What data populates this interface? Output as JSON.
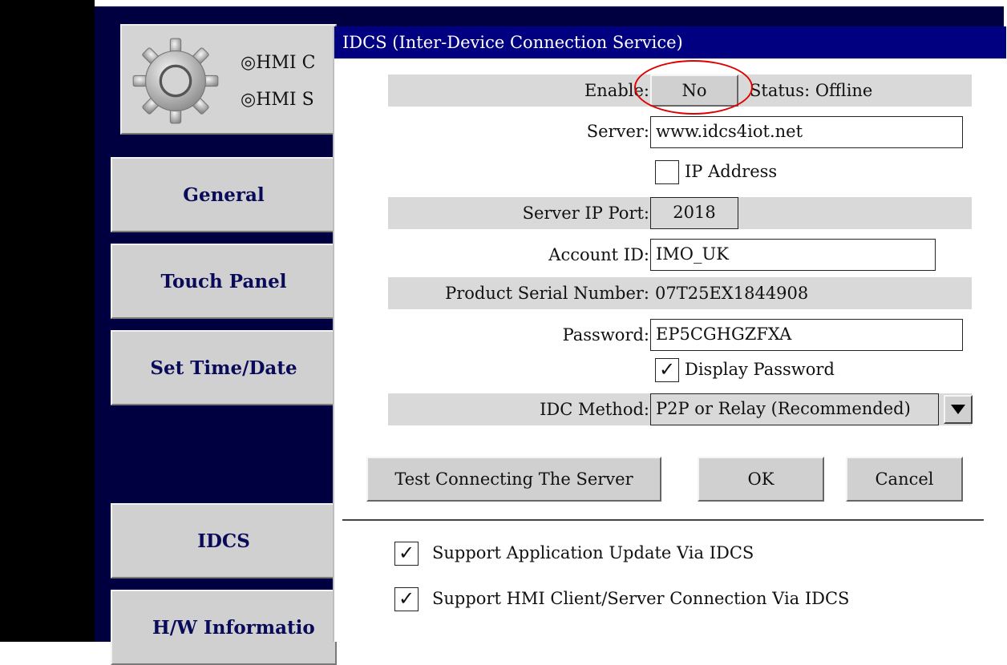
{
  "sidebar": {
    "radio_options": [
      "◎HMI C",
      "◎HMI S"
    ],
    "buttons": [
      "General",
      "Touch Panel",
      "Set Time/Date",
      "IDCS",
      "H/W Informatio"
    ]
  },
  "dialog": {
    "title": "IDCS (Inter-Device Connection Service)",
    "enable_label": "Enable:",
    "enable_value": "No",
    "status": "Status: Offline",
    "server_label": "Server:",
    "server_value": "www.idcs4iot.net",
    "ip_address_label": "IP Address",
    "ip_address_checked": false,
    "port_label": "Server IP Port:",
    "port_value": "2018",
    "account_label": "Account ID:",
    "account_value": "IMO_UK",
    "serial_label": "Product Serial Number:",
    "serial_value": "07T25EX1844908",
    "password_label": "Password:",
    "password_value": "EP5CGHGZFXA",
    "display_password_label": "Display Password",
    "display_password_checked": true,
    "method_label": "IDC Method:",
    "method_value": "P2P or Relay (Recommended)",
    "test_button": "Test Connecting The Server",
    "ok_button": "OK",
    "cancel_button": "Cancel",
    "support_update_label": "Support Application Update Via IDCS",
    "support_update_checked": true,
    "support_client_label": "Support HMI Client/Server Connection Via IDCS",
    "support_client_checked": true,
    "check_mark": "✓"
  },
  "colors": {
    "titlebar": "#000080",
    "navy_background": "#000040",
    "highlight_circle": "#e00000"
  }
}
